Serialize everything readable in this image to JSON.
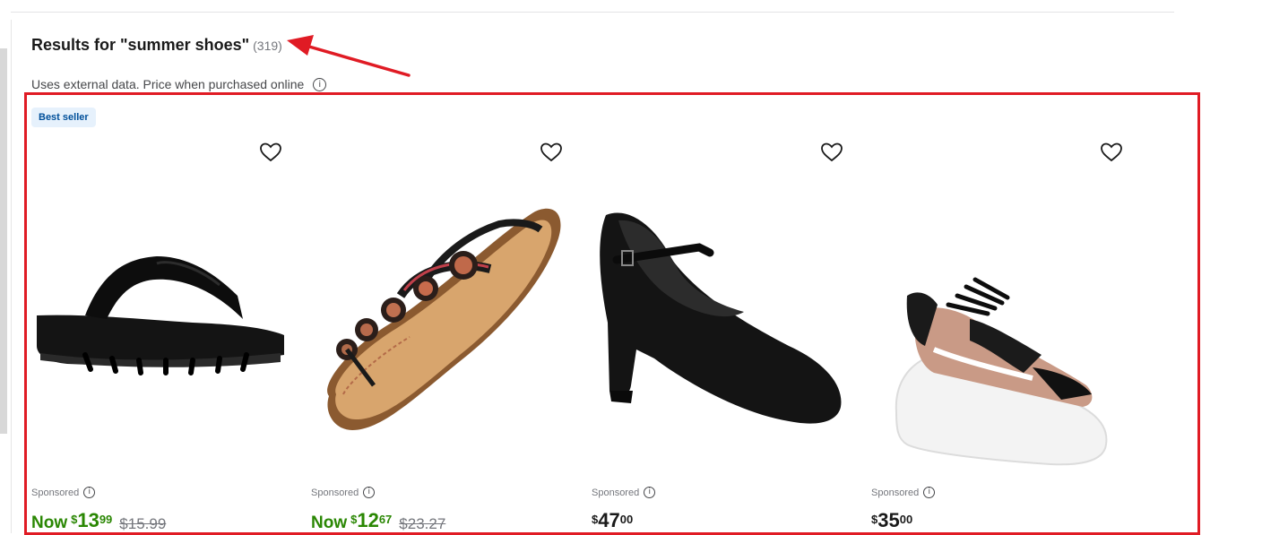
{
  "results": {
    "title": "Results for \"summer shoes\"",
    "count": "(319)",
    "subtext": "Uses external data. Price when purchased online",
    "info_symbol": "i"
  },
  "badge": "Best seller",
  "products": [
    {
      "image_icon": "flip-flop-sandal",
      "sponsored": "Sponsored",
      "price_prefix": "Now",
      "currency": "$",
      "dollars": "13",
      "cents": "99",
      "was_price": "$15.99"
    },
    {
      "image_icon": "beaded-thong-sandal",
      "sponsored": "Sponsored",
      "price_prefix": "Now",
      "currency": "$",
      "dollars": "12",
      "cents": "67",
      "was_price": "$23.27"
    },
    {
      "image_icon": "black-character-shoe",
      "sponsored": "Sponsored",
      "price_prefix": "",
      "currency": "$",
      "dollars": "47",
      "cents": "00",
      "was_price": ""
    },
    {
      "image_icon": "chunky-sneaker",
      "sponsored": "Sponsored",
      "price_prefix": "",
      "currency": "$",
      "dollars": "35",
      "cents": "00",
      "was_price": ""
    }
  ],
  "colors": {
    "accent_green": "#2a8703",
    "annotation_red": "#e01b24",
    "badge_bg": "#e6f1fc",
    "badge_text": "#004f9a"
  }
}
